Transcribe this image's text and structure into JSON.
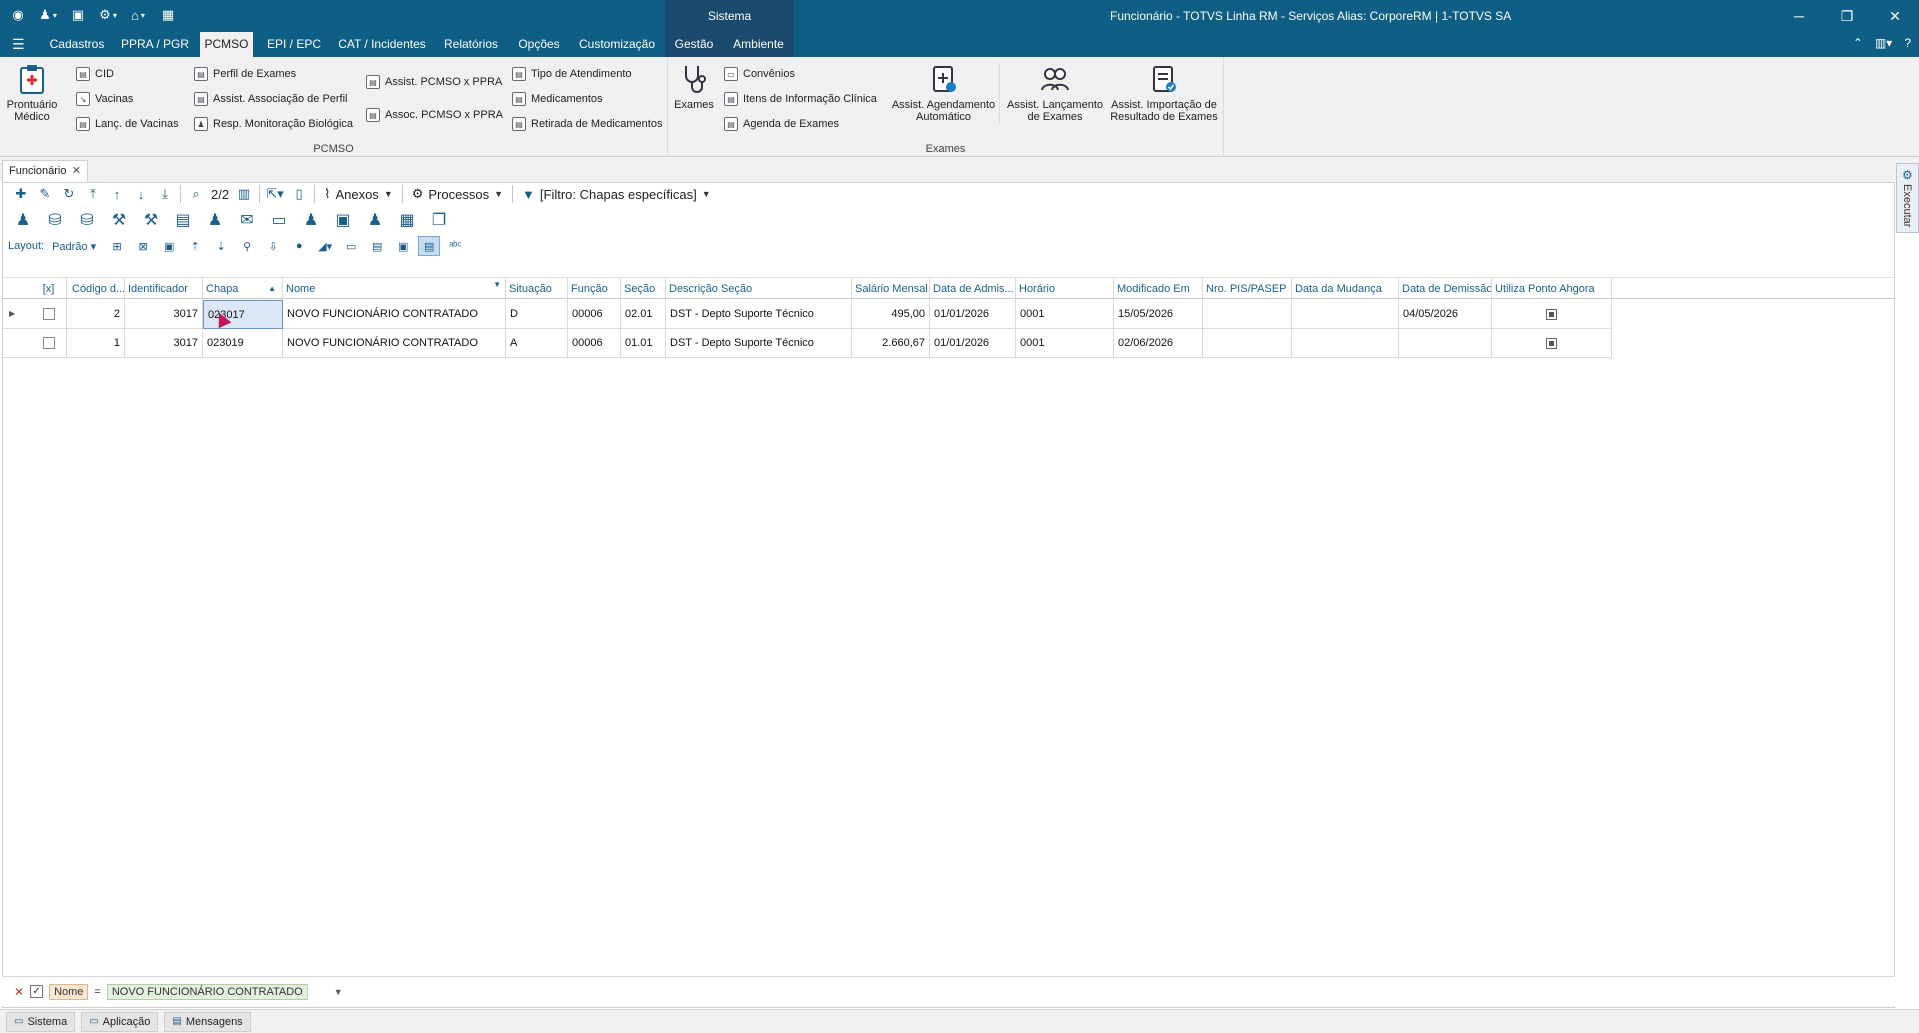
{
  "titlebar": {
    "system_tab": "Sistema",
    "window_title": "Funcionário - TOTVS Linha RM - Serviços  Alias: CorporeRM | 1-TOTVS SA"
  },
  "menu_tabs": [
    "Cadastros",
    "PPRA / PGR",
    "PCMSO",
    "EPI / EPC",
    "CAT / Incidentes",
    "Relatórios",
    "Opções",
    "Customização",
    "Gestão",
    "Ambiente"
  ],
  "active_tab": "PCMSO",
  "ribbon": {
    "pcmso_group_label": "PCMSO",
    "exames_group_label": "Exames",
    "prontuario_label": "Prontuário Médico",
    "col1": [
      "CID",
      "Vacinas",
      "Lanç. de Vacinas"
    ],
    "col2": [
      "Perfil de Exames",
      "Assist. Associação de  Perfil",
      "Resp. Monitoração Biológica"
    ],
    "col3": [
      "Assist. PCMSO x PPRA",
      "Assoc. PCMSO x PPRA"
    ],
    "col4": [
      "Tipo de Atendimento",
      "Medicamentos",
      "Retirada de Medicamentos"
    ],
    "exames_label": "Exames",
    "col5": [
      "Convênios",
      "Itens de Informação Clínica",
      "Agenda de Exames"
    ],
    "big_buttons": [
      {
        "line1": "Assist. Agendamento",
        "line2": "Automático"
      },
      {
        "line1": "Assist. Lançamento",
        "line2": "de Exames"
      },
      {
        "line1": "Assist. Importação de",
        "line2": "Resultado de Exames"
      }
    ]
  },
  "doc_tab": "Funcionário",
  "side_panel": "Executar",
  "toolbar": {
    "record_count": "2/2",
    "anexos": "Anexos",
    "processos": "Processos",
    "filtro": "[Filtro: Chapas específicas]"
  },
  "layout": {
    "label": "Layout:",
    "value": "Padrão"
  },
  "grid": {
    "columns": [
      "[x]",
      "Código d...",
      "Identificador",
      "Chapa",
      "Nome",
      "Situação",
      "Função",
      "Seção",
      "Descrição Seção",
      "Salário Mensal",
      "Data de Admis...",
      "Horário",
      "Modificado Em",
      "Nro. PIS/PASEP",
      "Data da Mudança",
      "Data de Demissão",
      "Utiliza Ponto Ahgora"
    ],
    "rows": [
      {
        "codigo": "2",
        "identificador": "3017",
        "chapa": "023017",
        "nome": "NOVO FUNCIONÁRIO CONTRATADO",
        "situacao": "D",
        "funcao": "00006",
        "secao": "02.01",
        "descricao": "DST - Depto Suporte Técnico",
        "salario": "495,00",
        "admissao": "01/01/2026",
        "horario": "0001",
        "modificado": "15/05/2026",
        "pis": "",
        "mudanca": "",
        "demissao": "04/05/2026"
      },
      {
        "codigo": "1",
        "identificador": "3017",
        "chapa": "023019",
        "nome": "NOVO FUNCIONÁRIO CONTRATADO",
        "situacao": "A",
        "funcao": "00006",
        "secao": "01.01",
        "descricao": "DST - Depto Suporte Técnico",
        "salario": "2.660,67",
        "admissao": "01/01/2026",
        "horario": "0001",
        "modificado": "02/06/2026",
        "pis": "",
        "mudanca": "",
        "demissao": ""
      }
    ]
  },
  "filter": {
    "field": "Nome",
    "operator": "=",
    "value": "NOVO FUNCIONÁRIO CONTRATADO"
  },
  "statusbar": [
    "Sistema",
    "Aplicação",
    "Mensagens"
  ]
}
